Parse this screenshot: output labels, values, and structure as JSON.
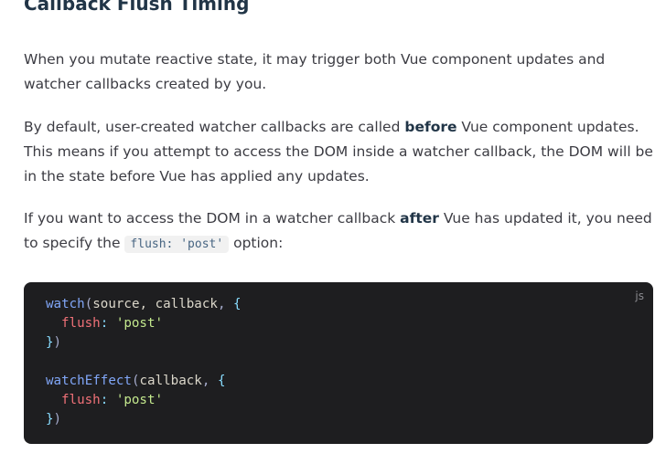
{
  "section": {
    "title": "Callback Flush Timing"
  },
  "paragraphs": {
    "p1": "When you mutate reactive state, it may trigger both Vue component updates and watcher callbacks created by you.",
    "p2_before": "By default, user-created watcher callbacks are called ",
    "p2_bold": "before",
    "p2_after": " Vue component updates. This means if you attempt to access the DOM inside a watcher callback, the DOM will be in the state before Vue has applied any updates.",
    "p3_before": "If you want to access the DOM in a watcher callback ",
    "p3_bold": "after",
    "p3_middle": " Vue has updated it, you need to specify the ",
    "p3_code": "flush: 'post'",
    "p3_after": " option:"
  },
  "code_block": {
    "language": "js",
    "lines": [
      {
        "fn": "watch",
        "open": "(",
        "args": "source, callback",
        "comma": ",",
        "brace_open": "{"
      },
      {
        "key": "flush",
        "colon": ":",
        "value": "'post'"
      },
      {
        "brace_close": "}",
        "close": ")"
      },
      {},
      {
        "fn": "watchEffect",
        "open": "(",
        "args": "callback",
        "comma": ",",
        "brace_open": "{"
      },
      {
        "key": "flush",
        "colon": ":",
        "value": "'post'"
      },
      {
        "brace_close": "}",
        "close": ")"
      }
    ]
  },
  "colors": {
    "text": "#3c3c43",
    "heading": "#213547",
    "code_bg": "#1e1e20",
    "inline_code_bg": "#f1f1f1",
    "inline_code_text": "#476582"
  }
}
